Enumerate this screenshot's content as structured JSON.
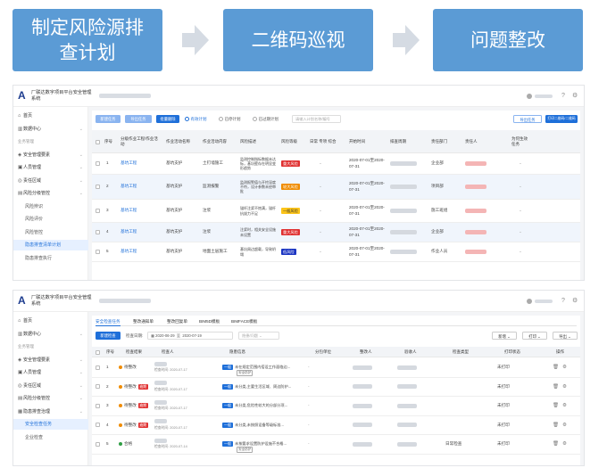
{
  "flow": {
    "step1": "制定风险源排查计划",
    "step2": "二维码巡视",
    "step3": "问题整改"
  },
  "screen1": {
    "app_title": "厂联达数字项目平台安全管理系统",
    "nav": [
      {
        "icon": "home-icon",
        "label": "首页"
      },
      {
        "icon": "chart-icon",
        "label": "数据中心"
      },
      {
        "label": "业务管理",
        "section": true
      },
      {
        "icon": "shield-icon",
        "label": "安全管理要素"
      },
      {
        "icon": "users-icon",
        "label": "人员管理"
      },
      {
        "icon": "location-icon",
        "label": "责任区域"
      },
      {
        "icon": "risk-icon",
        "label": "风险分级管控"
      },
      {
        "label": "风险辨识",
        "sub": true
      },
      {
        "label": "风险评价",
        "sub": true
      },
      {
        "label": "风险管控",
        "sub": true
      },
      {
        "label": "隐患排查清单计划",
        "sub": true,
        "active": true
      },
      {
        "label": "隐患排查执行",
        "sub": true
      }
    ],
    "toolbar": {
      "btn1": "新建任务",
      "btn2": "导出任务",
      "btn3": "批量删除",
      "radio1": "有效计划",
      "radio2": "已停计划",
      "radio3": "已过期计划",
      "search_placeholder": "请输入计划名称/编号",
      "btn_right1": "导出任务",
      "btn_right2": "打印二维码/二维码"
    },
    "columns": [
      "序号",
      "分级作业工程/作业活动",
      "作业活动名称",
      "作业活动内容",
      "风险描述",
      "风险等级",
      "日常 专项 综合",
      "开始时间",
      "排查周期",
      "责任部门",
      "责任人",
      "为何生效任务"
    ],
    "rows": [
      {
        "no": "1",
        "project": "基坑工程",
        "activity": "基坑支护",
        "content": "土钉墙施工",
        "desc": "监测控制指标数据未达标，基坑壁存在明显变形趋势",
        "level": "重大风险",
        "level_color": "red",
        "time": "2020-07-01至2020-07-31",
        "dept": "企业部"
      },
      {
        "no": "2",
        "project": "基坑工程",
        "activity": "基坑支护",
        "content": "监测报警",
        "desc": "监测报警值与开挖深度不符，设计参数未经审批",
        "level": "较大风险",
        "level_color": "orange",
        "time": "2020-07-01至2020-07-31",
        "dept": "项目部"
      },
      {
        "no": "3",
        "project": "基坑工程",
        "activity": "基坑支护",
        "content": "注浆",
        "desc": "锚杆注浆不饱满，锚杆抗拔力不足",
        "level": "一般风险",
        "level_color": "yellow",
        "time": "2020-07-01至2020-07-31",
        "dept": "施工班组"
      },
      {
        "no": "4",
        "project": "基坑工程",
        "activity": "基坑支护",
        "content": "注浆",
        "desc": "注浆时，相关安全设施未设置",
        "level": "重大风险",
        "level_color": "red",
        "time": "2020-07-01至2020-07-31",
        "dept": "企业部"
      },
      {
        "no": "5",
        "project": "基坑工程",
        "activity": "基坑支护",
        "content": "地面土层施工",
        "desc": "基坑周边超载，导致坍塌",
        "level": "低风险",
        "level_color": "blue",
        "time": "2020-07-01至2020-07-31",
        "dept": "作业人员"
      }
    ]
  },
  "screen2": {
    "app_title": "厂联达数字项目平台安全管理系统",
    "nav": [
      {
        "icon": "home-icon",
        "label": "首页"
      },
      {
        "icon": "chart-icon",
        "label": "数据中心"
      },
      {
        "label": "业务管理",
        "section": true
      },
      {
        "icon": "shield-icon",
        "label": "安全管理要素"
      },
      {
        "icon": "users-icon",
        "label": "人员管理"
      },
      {
        "icon": "location-icon",
        "label": "责任区域"
      },
      {
        "icon": "risk-icon",
        "label": "风险分级管控"
      },
      {
        "icon": "check-icon",
        "label": "隐患排查治理"
      },
      {
        "label": "安全检查任务",
        "sub": true,
        "active": true
      },
      {
        "label": "企业检查",
        "sub": true
      }
    ],
    "tabs": [
      "安全检查任务",
      "整改通知单",
      "整改回复单",
      "BIM5D模板",
      "BIMFACE模板"
    ],
    "filter": {
      "btn_new": "新建检查",
      "date_label": "检查日期:",
      "date_from": "2020-06-29",
      "date_sep": "至",
      "date_to": "2020-07-19",
      "status_placeholder": "隐患/问题",
      "btn_new2": "新增",
      "btn_print": "打印",
      "btn_export": "导出"
    },
    "columns": [
      "序号",
      "检查结果",
      "检查人",
      "隐患信息",
      "分包单位",
      "整改人",
      "验收人",
      "检查类型",
      "打印状态",
      "操作"
    ],
    "rows": [
      {
        "no": "1",
        "status": "待整改",
        "overdue": "",
        "time": "检查时间: 2020-07-17",
        "level": "一般",
        "info": "未在规定范围内搭设工作面临边...",
        "tag": "安全防护",
        "print": "未打印"
      },
      {
        "no": "2",
        "status": "待整改",
        "overdue": "逾期",
        "time": "检查时间: 2020-07-17",
        "level": "一般",
        "info": "未分类,主要生活区域、周边防护...",
        "tag": "",
        "print": "未打印"
      },
      {
        "no": "3",
        "status": "待整改",
        "overdue": "逾期",
        "time": "检查时间: 2020-07-17",
        "level": "一般",
        "info": "未分类,危险性较大的分部分项...",
        "tag": "",
        "print": "未打印"
      },
      {
        "no": "4",
        "status": "待整改",
        "overdue": "逾期",
        "time": "检查时间: 2020-07-17",
        "level": "一般",
        "info": "未分类,未按照设备等级标准...",
        "tag": "",
        "print": "未打印"
      },
      {
        "no": "5",
        "status": "合格",
        "overdue": "",
        "time": "检查时间: 2020-07-14",
        "level": "一般",
        "info": "未按要求设置防护设施不合格...",
        "tag": "安全防护",
        "type": "日常检查",
        "print": "未打印"
      }
    ]
  }
}
